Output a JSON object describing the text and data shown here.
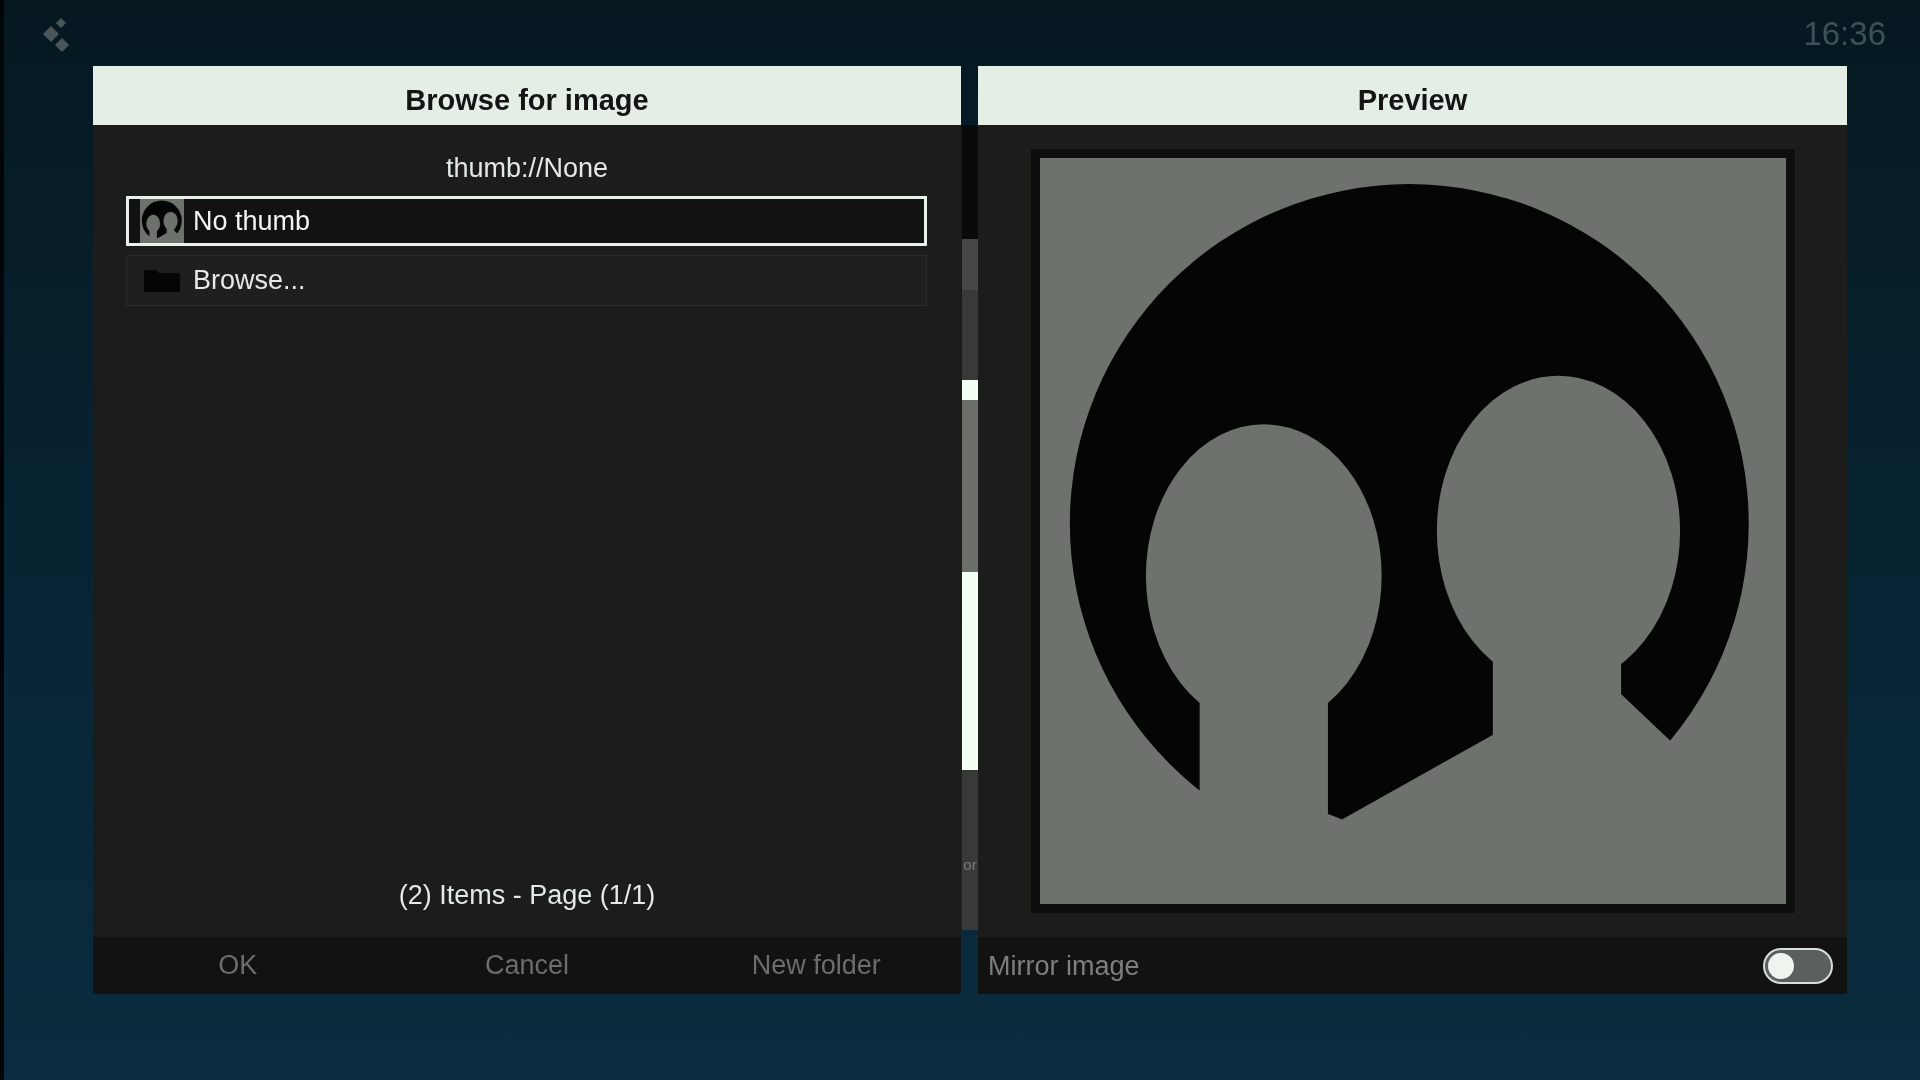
{
  "clock": "16:36",
  "background_window": {
    "text": "or"
  },
  "browse_dialog": {
    "title": "Browse for image",
    "path": "thumb://None",
    "items": [
      {
        "label": "No thumb",
        "kind": "thumbnail",
        "selected": true
      },
      {
        "label": "Browse...",
        "kind": "folder",
        "selected": false
      }
    ],
    "page_info": "(2) Items - Page (1/1)",
    "buttons": [
      "OK",
      "Cancel",
      "New folder"
    ]
  },
  "preview_dialog": {
    "title": "Preview",
    "mirror_image": {
      "label": "Mirror image",
      "on": false
    }
  }
}
